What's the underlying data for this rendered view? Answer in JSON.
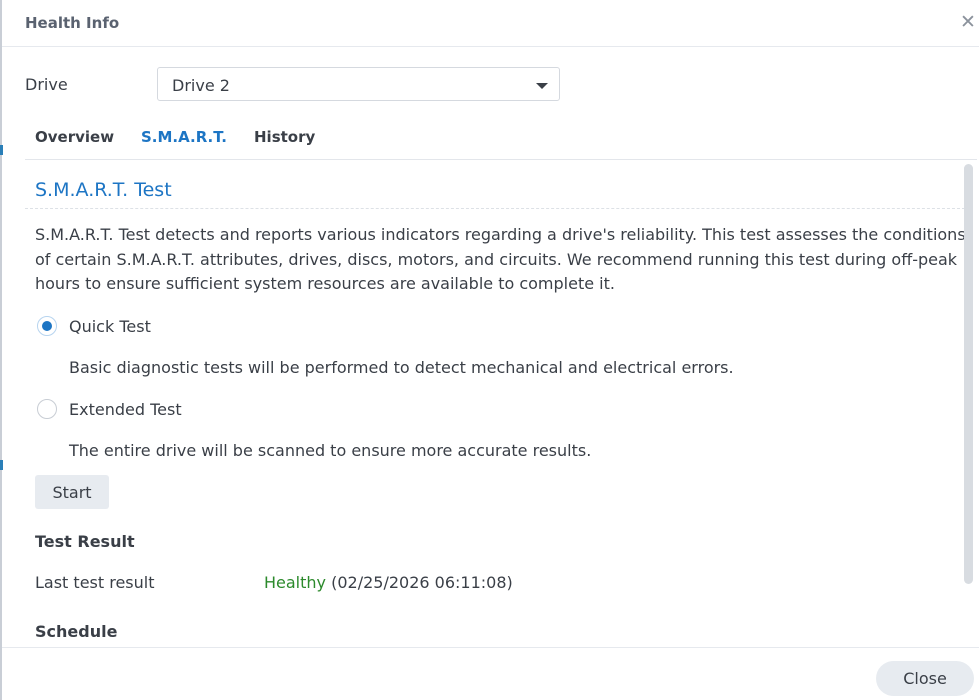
{
  "dialog": {
    "title": "Health Info",
    "close_icon": "close-icon"
  },
  "drive": {
    "label": "Drive",
    "selected": "Drive 2"
  },
  "tabs": [
    {
      "label": "Overview",
      "active": false
    },
    {
      "label": "S.M.A.R.T.",
      "active": true
    },
    {
      "label": "History",
      "active": false
    }
  ],
  "smart": {
    "title": "S.M.A.R.T. Test",
    "description": "S.M.A.R.T. Test detects and reports various indicators regarding a drive's reliability. This test assesses the conditions of certain S.M.A.R.T. attributes, drives, discs, motors, and circuits. We recommend running this test during off-peak hours to ensure sufficient system resources are available to complete it.",
    "options": [
      {
        "label": "Quick Test",
        "description": "Basic diagnostic tests will be performed to detect mechanical and electrical errors.",
        "checked": true
      },
      {
        "label": "Extended Test",
        "description": "The entire drive will be scanned to ensure more accurate results.",
        "checked": false
      }
    ],
    "start_label": "Start"
  },
  "result": {
    "heading": "Test Result",
    "last_label": "Last test result",
    "status": "Healthy",
    "timestamp": "(02/25/2026 06:11:08)"
  },
  "schedule": {
    "heading": "Schedule"
  },
  "footer": {
    "close_label": "Close"
  },
  "colors": {
    "accent": "#1d75c4",
    "healthy": "#2c8a2c",
    "button_bg": "#e7ebf0"
  }
}
